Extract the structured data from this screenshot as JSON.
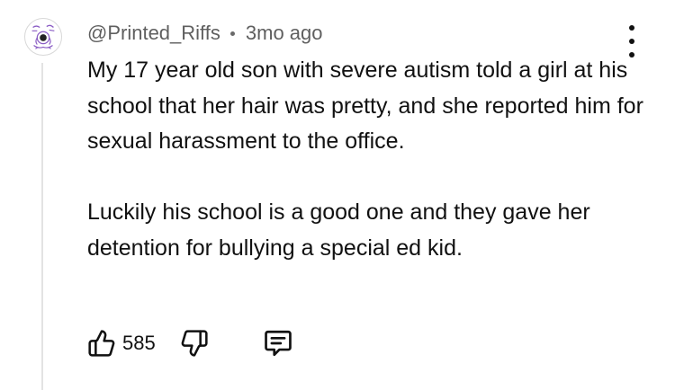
{
  "comment": {
    "author": "@Printed_Riffs",
    "separator": "•",
    "time_ago": "3mo ago",
    "paragraphs": [
      "My 17 year old son with severe autism told a girl at his school that her hair was pretty, and she reported him for sexual harassment to the office.",
      "Luckily his school is a good one and they gave her detention for bullying a special ed kid."
    ],
    "like_count": "585"
  },
  "icons": {
    "avatar": "avatar-illustration",
    "more": "more-vertical-icon",
    "like": "thumbs-up-icon",
    "dislike": "thumbs-down-icon",
    "reply": "comment-bubble-icon"
  },
  "colors": {
    "text": "#111111",
    "meta": "#5f5f5f",
    "thread_line": "#e3e3e3",
    "avatar_accent": "#8a5cc4"
  }
}
